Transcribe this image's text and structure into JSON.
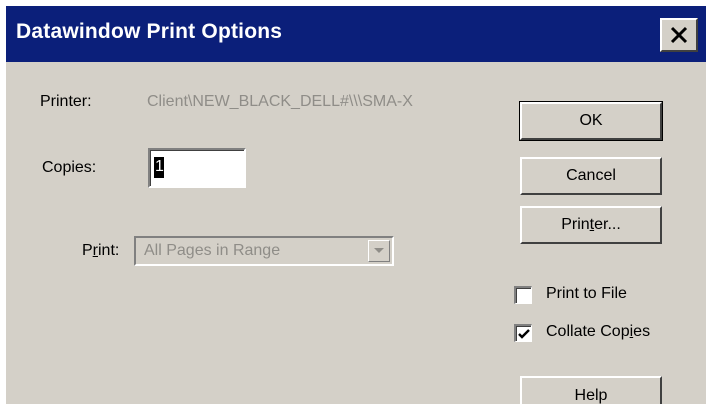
{
  "window": {
    "title": "Datawindow Print Options",
    "close_glyph": "close-icon"
  },
  "printer": {
    "label": "Printer:",
    "value": "Client\\NEW_BLACK_DELL#\\\\\\SMA-X"
  },
  "copies": {
    "label": "Copies:",
    "value": "1"
  },
  "print_range": {
    "label_pre": "P",
    "label_underlined": "r",
    "label_post": "int:",
    "selected": "All Pages in Range"
  },
  "buttons": {
    "ok": "OK",
    "cancel": "Cancel",
    "printer_pre": "Prin",
    "printer_underlined": "t",
    "printer_post": "er...",
    "help": "Help"
  },
  "options": {
    "print_to_file": {
      "label": "Print to File",
      "checked": false
    },
    "collate": {
      "label_pre": "Collate Cop",
      "label_underlined": "i",
      "label_post": "es",
      "checked": true
    }
  },
  "colors": {
    "titlebar": "#0b1f7a",
    "face": "#d4d0c8",
    "disabled_text": "#8f8d88"
  }
}
